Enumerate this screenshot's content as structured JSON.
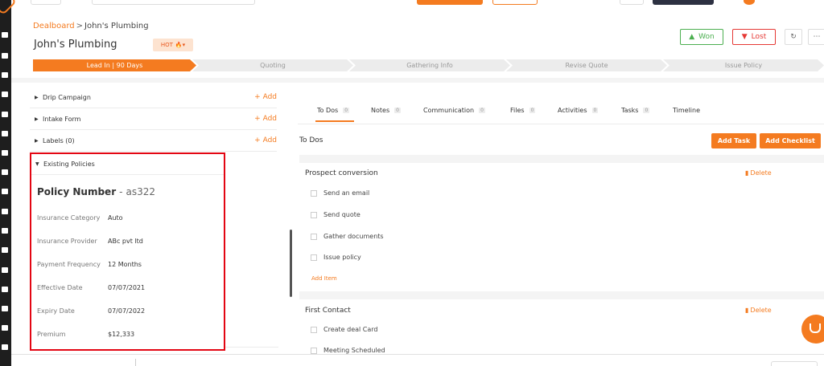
{
  "breadcrumb": {
    "link": "Dealboard",
    "separator": ">",
    "current": "John's Plumbing"
  },
  "deal": {
    "title": "John's Plumbing",
    "badge": "HOT",
    "badge_icon": "🔥▾"
  },
  "actions": {
    "won": "Won",
    "lost": "Lost",
    "refresh_icon": "↻",
    "more_icon": "⋯"
  },
  "stages": [
    "Lead In | 90 Days",
    "Quoting",
    "Gathering Info",
    "Revise Quote",
    "Issue Policy"
  ],
  "sections": [
    {
      "label": "Drip Campaign",
      "add": "+ Add"
    },
    {
      "label": "Intake Form",
      "add": "+ Add"
    },
    {
      "label": "Labels (0)",
      "add": "+ Add"
    }
  ],
  "policy": {
    "header": "Existing Policies",
    "number_label": "Policy Number",
    "number_sep": "-",
    "number_value": "as322",
    "rows": [
      {
        "label": "Insurance Category",
        "value": "Auto"
      },
      {
        "label": "Insurance Provider",
        "value": "ABc pvt ltd"
      },
      {
        "label": "Payment Frequency",
        "value": "12 Months"
      },
      {
        "label": "Effective Date",
        "value": "07/07/2021"
      },
      {
        "label": "Expiry Date",
        "value": "07/07/2022"
      },
      {
        "label": "Premium",
        "value": "$12,333"
      }
    ]
  },
  "tabs": [
    {
      "label": "To Dos",
      "count": "0"
    },
    {
      "label": "Notes",
      "count": "0"
    },
    {
      "label": "Communication",
      "count": "0"
    },
    {
      "label": "Files",
      "count": "0"
    },
    {
      "label": "Activities",
      "count": "0"
    },
    {
      "label": "Tasks",
      "count": "0"
    },
    {
      "label": "Timeline"
    }
  ],
  "todos": {
    "title": "To Dos",
    "add_task": "Add Task",
    "add_checklist": "Add Checklist",
    "delete": "Delete",
    "add_item": "Add Item",
    "checklists": [
      {
        "title": "Prospect conversion",
        "items": [
          "Send an email",
          "Send quote",
          "Gather documents",
          "Issue policy"
        ]
      },
      {
        "title": "First Contact",
        "items": [
          "Create deal Card",
          "Meeting Scheduled"
        ]
      }
    ]
  },
  "colors": {
    "accent": "#f47b20",
    "won": "#4caf50",
    "lost": "#e53935",
    "highlight": "#e30613"
  }
}
